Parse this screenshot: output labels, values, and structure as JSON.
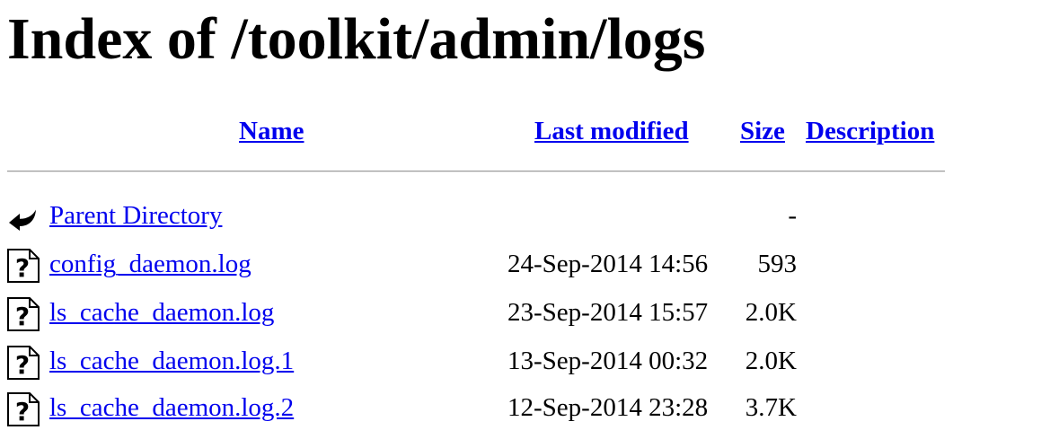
{
  "page": {
    "title": "Index of /toolkit/admin/logs"
  },
  "columns": {
    "name": "Name",
    "last_modified": "Last modified",
    "size": "Size",
    "description": "Description"
  },
  "entries": [
    {
      "icon": "back-arrow-icon",
      "name": "Parent Directory",
      "modified": "",
      "size": "-"
    },
    {
      "icon": "unknown-file-icon",
      "name": "config_daemon.log",
      "modified": "24-Sep-2014 14:56",
      "size": "593"
    },
    {
      "icon": "unknown-file-icon",
      "name": "ls_cache_daemon.log",
      "modified": "23-Sep-2014 15:57",
      "size": "2.0K"
    },
    {
      "icon": "unknown-file-icon",
      "name": "ls_cache_daemon.log.1",
      "modified": "13-Sep-2014 00:32",
      "size": "2.0K"
    },
    {
      "icon": "unknown-file-icon",
      "name": "ls_cache_daemon.log.2",
      "modified": "12-Sep-2014 23:28",
      "size": "3.7K"
    }
  ],
  "colors": {
    "link": "#0000ee",
    "text": "#000000",
    "background": "#ffffff"
  }
}
